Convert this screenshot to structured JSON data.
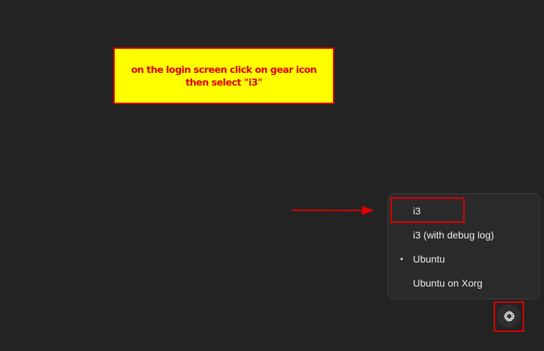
{
  "annotation": {
    "line1": "on the login screen click on gear icon",
    "line2": "then select \"i3\""
  },
  "session_menu": {
    "items": [
      {
        "label": "i3",
        "selected": false
      },
      {
        "label": "i3 (with debug log)",
        "selected": false
      },
      {
        "label": "Ubuntu",
        "selected": true
      },
      {
        "label": "Ubuntu on Xorg",
        "selected": false
      }
    ],
    "selected_marker": "•"
  },
  "gear_button": {
    "icon": "gear-icon"
  },
  "colors": {
    "background": "#232323",
    "callout_fill": "#ffff00",
    "annotation_red": "#e00000",
    "menu_bg": "#2a2a2a",
    "menu_text": "#eeeeee"
  }
}
